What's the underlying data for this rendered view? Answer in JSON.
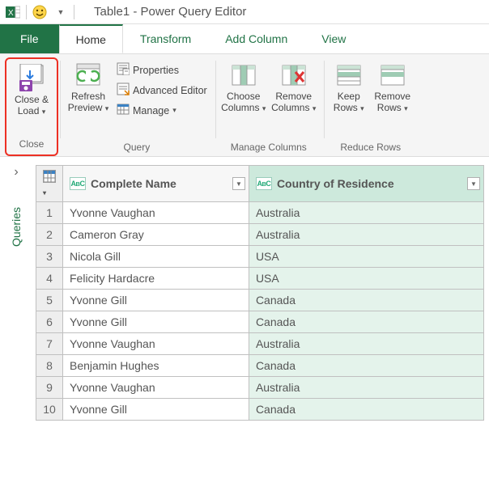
{
  "title": "Table1 - Power Query Editor",
  "tabs": {
    "file": "File",
    "home": "Home",
    "transform": "Transform",
    "add": "Add Column",
    "view": "View"
  },
  "ribbon": {
    "close": {
      "close_load": "Close & Load",
      "group": "Close"
    },
    "query": {
      "refresh": "Refresh Preview",
      "properties": "Properties",
      "advanced": "Advanced Editor",
      "manage": "Manage",
      "group": "Query"
    },
    "cols": {
      "choose": "Choose Columns",
      "remove": "Remove Columns",
      "group": "Manage Columns"
    },
    "rows": {
      "keep": "Keep Rows",
      "remove": "Remove Rows",
      "group": "Reduce Rows"
    }
  },
  "sidebar": {
    "label": "Queries"
  },
  "table": {
    "col1": "Complete Name",
    "col2": "Country of Residence",
    "rows": [
      {
        "n": "1",
        "name": "Yvonne Vaughan",
        "country": "Australia"
      },
      {
        "n": "2",
        "name": "Cameron Gray",
        "country": "Australia"
      },
      {
        "n": "3",
        "name": "Nicola Gill",
        "country": "USA"
      },
      {
        "n": "4",
        "name": "Felicity Hardacre",
        "country": "USA"
      },
      {
        "n": "5",
        "name": "Yvonne Gill",
        "country": "Canada"
      },
      {
        "n": "6",
        "name": "Yvonne Gill",
        "country": "Canada"
      },
      {
        "n": "7",
        "name": "Yvonne Vaughan",
        "country": "Australia"
      },
      {
        "n": "8",
        "name": "Benjamin Hughes",
        "country": "Canada"
      },
      {
        "n": "9",
        "name": "Yvonne Vaughan",
        "country": "Australia"
      },
      {
        "n": "10",
        "name": "Yvonne Gill",
        "country": "Canada"
      }
    ]
  }
}
